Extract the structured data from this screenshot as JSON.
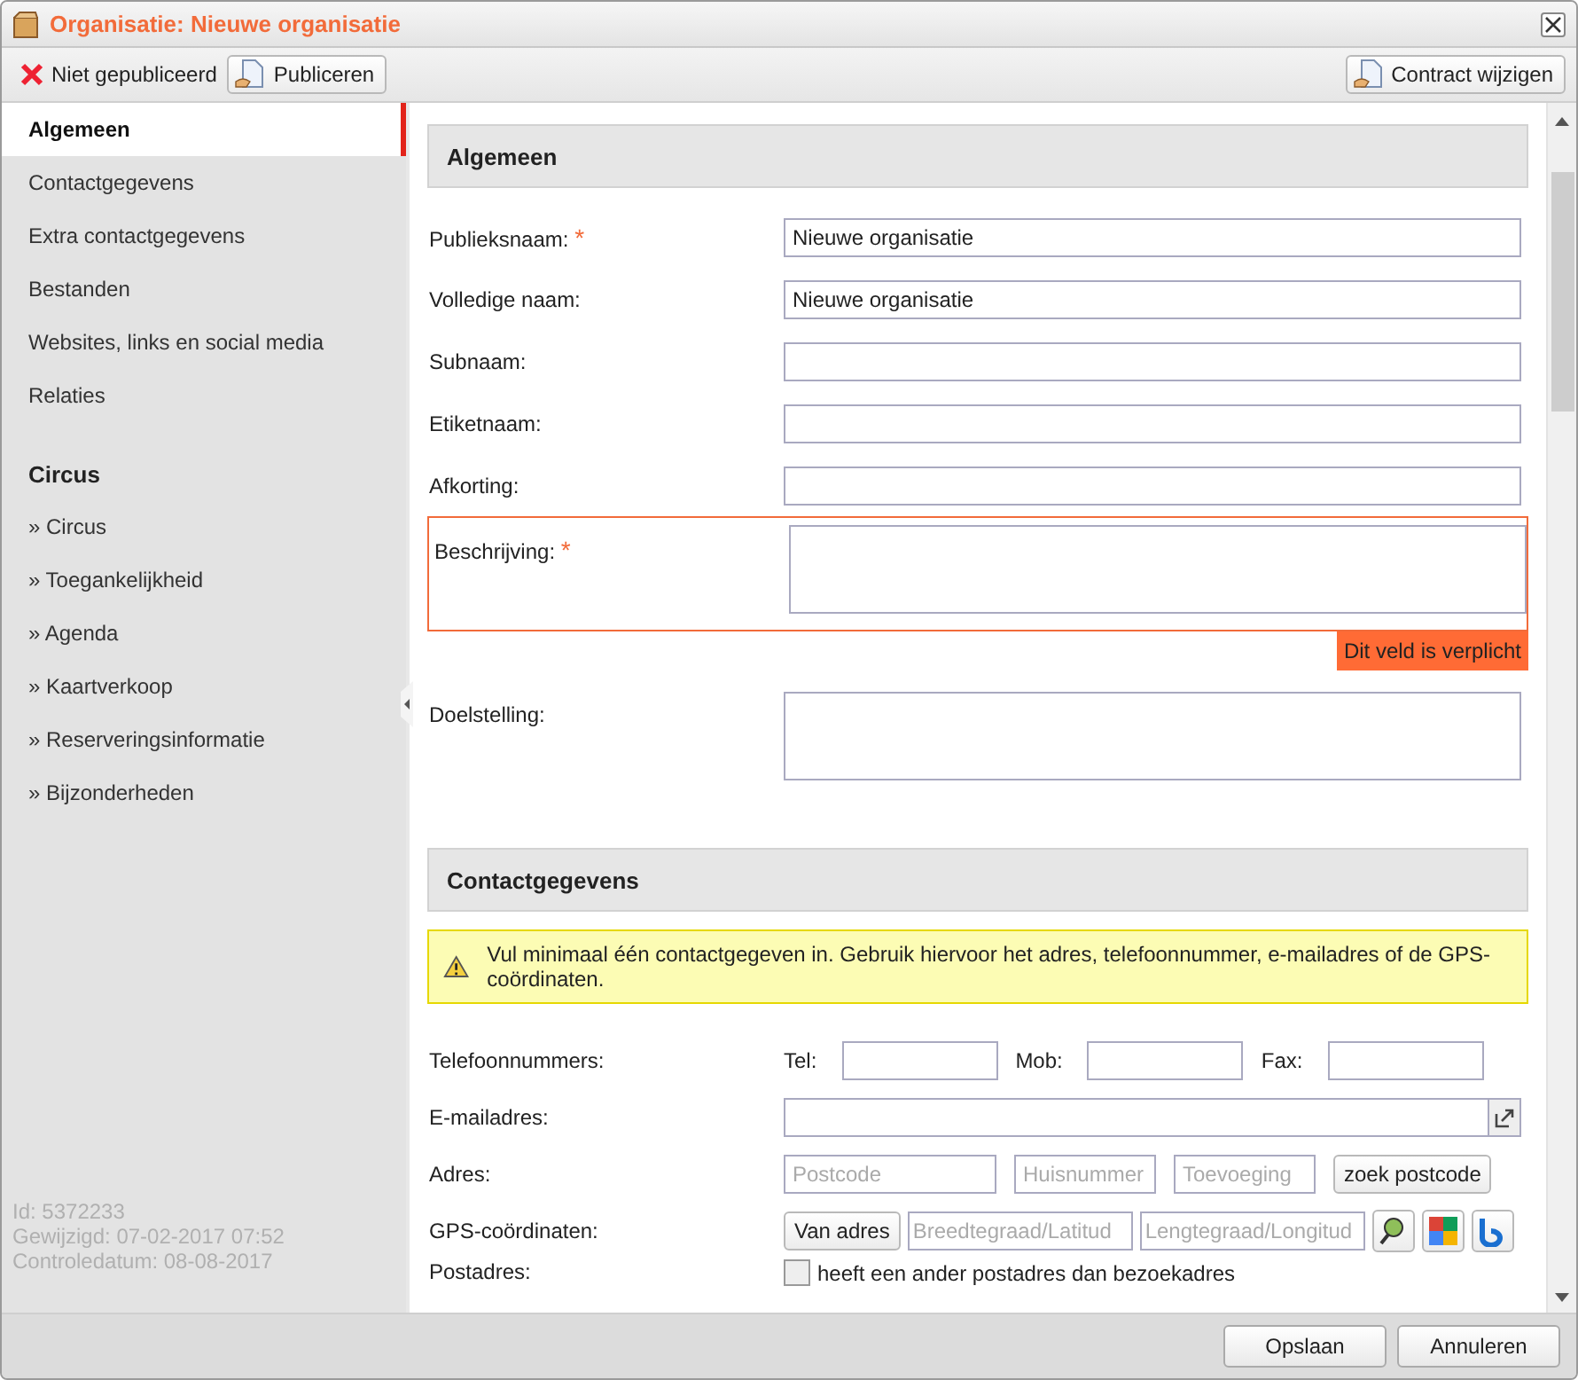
{
  "window": {
    "title": "Organisatie: Nieuwe organisatie"
  },
  "toolbar": {
    "status": {
      "label": "Niet gepubliceerd",
      "published": false
    },
    "publish_button": "Publiceren",
    "contract_button": "Contract wijzigen"
  },
  "sidebar": {
    "groups": [
      {
        "items": [
          {
            "label": "Algemeen",
            "selected": true
          },
          {
            "label": "Contactgegevens",
            "selected": false
          },
          {
            "label": "Extra contactgegevens",
            "selected": false
          },
          {
            "label": "Bestanden",
            "selected": false
          },
          {
            "label": "Websites, links en social media",
            "selected": false
          },
          {
            "label": "Relaties",
            "selected": false
          }
        ]
      },
      {
        "heading": "Circus",
        "items": [
          {
            "label": "» Circus",
            "selected": false
          },
          {
            "label": "» Toegankelijkheid",
            "selected": false
          },
          {
            "label": "» Agenda",
            "selected": false
          },
          {
            "label": "» Kaartverkoop",
            "selected": false
          },
          {
            "label": "» Reserveringsinformatie",
            "selected": false
          },
          {
            "label": "» Bijzonderheden",
            "selected": false
          }
        ]
      }
    ],
    "meta": [
      "Id: 5372233",
      "Gewijzigd: 07-02-2017 07:52",
      "Controledatum: 08-08-2017"
    ]
  },
  "required_marker": "*",
  "sections": [
    {
      "title": "Algemeen",
      "fields": [
        {
          "kind": "text",
          "label": "Publieksnaam:",
          "required": true,
          "value": "Nieuwe organisatie"
        },
        {
          "kind": "text",
          "label": "Volledige naam:",
          "required": false,
          "value": "Nieuwe organisatie"
        },
        {
          "kind": "text",
          "label": "Subnaam:",
          "required": false
        },
        {
          "kind": "text",
          "label": "Etiketnaam:",
          "required": false
        },
        {
          "kind": "text",
          "label": "Afkorting:",
          "required": false
        },
        {
          "kind": "textarea",
          "label": "Beschrijving:",
          "required": true,
          "error": "Dit veld is verplicht"
        },
        {
          "kind": "textarea",
          "label": "Doelstelling:",
          "required": false
        }
      ]
    },
    {
      "title": "Contactgegevens",
      "notice": "Vul minimaal één contactgegeven in. Gebruik hiervoor het adres, telefoonnummer, e-mailadres of de GPS-coördinaten.",
      "fields": [
        {
          "kind": "phones",
          "label": "Telefoonnummers:",
          "parts": [
            "Tel:",
            "Mob:",
            "Fax:"
          ]
        },
        {
          "kind": "email",
          "label": "E-mailadres:"
        },
        {
          "kind": "address",
          "label": "Adres:",
          "placeholders": [
            "Postcode",
            "Huisnummer",
            "Toevoeging"
          ],
          "button": "zoek postcode"
        },
        {
          "kind": "gps",
          "label": "GPS-coördinaten:",
          "button": "Van adres",
          "placeholders": [
            "Breedtegraad/Latitud",
            "Lengtegraad/Longitud"
          ]
        },
        {
          "kind": "checkbox",
          "label": "Postadres:",
          "text": "heeft een ander postadres dan bezoekadres",
          "checked": false
        }
      ]
    }
  ],
  "footer": {
    "buttons": [
      "Opslaan",
      "Annuleren"
    ]
  }
}
